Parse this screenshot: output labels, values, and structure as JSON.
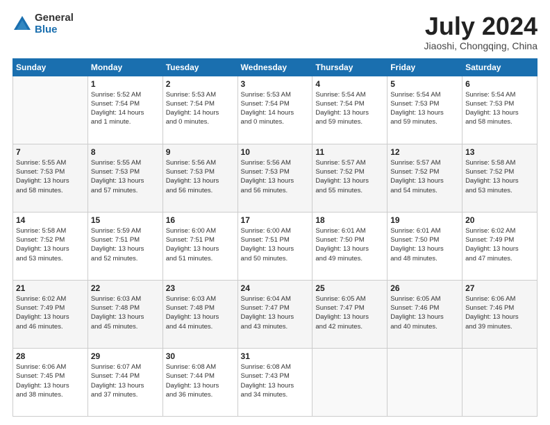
{
  "header": {
    "logo_general": "General",
    "logo_blue": "Blue",
    "title": "July 2024",
    "location": "Jiaoshi, Chongqing, China"
  },
  "weekdays": [
    "Sunday",
    "Monday",
    "Tuesday",
    "Wednesday",
    "Thursday",
    "Friday",
    "Saturday"
  ],
  "weeks": [
    [
      {
        "day": "",
        "lines": []
      },
      {
        "day": "1",
        "lines": [
          "Sunrise: 5:52 AM",
          "Sunset: 7:54 PM",
          "Daylight: 14 hours",
          "and 1 minute."
        ]
      },
      {
        "day": "2",
        "lines": [
          "Sunrise: 5:53 AM",
          "Sunset: 7:54 PM",
          "Daylight: 14 hours",
          "and 0 minutes."
        ]
      },
      {
        "day": "3",
        "lines": [
          "Sunrise: 5:53 AM",
          "Sunset: 7:54 PM",
          "Daylight: 14 hours",
          "and 0 minutes."
        ]
      },
      {
        "day": "4",
        "lines": [
          "Sunrise: 5:54 AM",
          "Sunset: 7:54 PM",
          "Daylight: 13 hours",
          "and 59 minutes."
        ]
      },
      {
        "day": "5",
        "lines": [
          "Sunrise: 5:54 AM",
          "Sunset: 7:53 PM",
          "Daylight: 13 hours",
          "and 59 minutes."
        ]
      },
      {
        "day": "6",
        "lines": [
          "Sunrise: 5:54 AM",
          "Sunset: 7:53 PM",
          "Daylight: 13 hours",
          "and 58 minutes."
        ]
      }
    ],
    [
      {
        "day": "7",
        "lines": [
          "Sunrise: 5:55 AM",
          "Sunset: 7:53 PM",
          "Daylight: 13 hours",
          "and 58 minutes."
        ]
      },
      {
        "day": "8",
        "lines": [
          "Sunrise: 5:55 AM",
          "Sunset: 7:53 PM",
          "Daylight: 13 hours",
          "and 57 minutes."
        ]
      },
      {
        "day": "9",
        "lines": [
          "Sunrise: 5:56 AM",
          "Sunset: 7:53 PM",
          "Daylight: 13 hours",
          "and 56 minutes."
        ]
      },
      {
        "day": "10",
        "lines": [
          "Sunrise: 5:56 AM",
          "Sunset: 7:53 PM",
          "Daylight: 13 hours",
          "and 56 minutes."
        ]
      },
      {
        "day": "11",
        "lines": [
          "Sunrise: 5:57 AM",
          "Sunset: 7:52 PM",
          "Daylight: 13 hours",
          "and 55 minutes."
        ]
      },
      {
        "day": "12",
        "lines": [
          "Sunrise: 5:57 AM",
          "Sunset: 7:52 PM",
          "Daylight: 13 hours",
          "and 54 minutes."
        ]
      },
      {
        "day": "13",
        "lines": [
          "Sunrise: 5:58 AM",
          "Sunset: 7:52 PM",
          "Daylight: 13 hours",
          "and 53 minutes."
        ]
      }
    ],
    [
      {
        "day": "14",
        "lines": [
          "Sunrise: 5:58 AM",
          "Sunset: 7:52 PM",
          "Daylight: 13 hours",
          "and 53 minutes."
        ]
      },
      {
        "day": "15",
        "lines": [
          "Sunrise: 5:59 AM",
          "Sunset: 7:51 PM",
          "Daylight: 13 hours",
          "and 52 minutes."
        ]
      },
      {
        "day": "16",
        "lines": [
          "Sunrise: 6:00 AM",
          "Sunset: 7:51 PM",
          "Daylight: 13 hours",
          "and 51 minutes."
        ]
      },
      {
        "day": "17",
        "lines": [
          "Sunrise: 6:00 AM",
          "Sunset: 7:51 PM",
          "Daylight: 13 hours",
          "and 50 minutes."
        ]
      },
      {
        "day": "18",
        "lines": [
          "Sunrise: 6:01 AM",
          "Sunset: 7:50 PM",
          "Daylight: 13 hours",
          "and 49 minutes."
        ]
      },
      {
        "day": "19",
        "lines": [
          "Sunrise: 6:01 AM",
          "Sunset: 7:50 PM",
          "Daylight: 13 hours",
          "and 48 minutes."
        ]
      },
      {
        "day": "20",
        "lines": [
          "Sunrise: 6:02 AM",
          "Sunset: 7:49 PM",
          "Daylight: 13 hours",
          "and 47 minutes."
        ]
      }
    ],
    [
      {
        "day": "21",
        "lines": [
          "Sunrise: 6:02 AM",
          "Sunset: 7:49 PM",
          "Daylight: 13 hours",
          "and 46 minutes."
        ]
      },
      {
        "day": "22",
        "lines": [
          "Sunrise: 6:03 AM",
          "Sunset: 7:48 PM",
          "Daylight: 13 hours",
          "and 45 minutes."
        ]
      },
      {
        "day": "23",
        "lines": [
          "Sunrise: 6:03 AM",
          "Sunset: 7:48 PM",
          "Daylight: 13 hours",
          "and 44 minutes."
        ]
      },
      {
        "day": "24",
        "lines": [
          "Sunrise: 6:04 AM",
          "Sunset: 7:47 PM",
          "Daylight: 13 hours",
          "and 43 minutes."
        ]
      },
      {
        "day": "25",
        "lines": [
          "Sunrise: 6:05 AM",
          "Sunset: 7:47 PM",
          "Daylight: 13 hours",
          "and 42 minutes."
        ]
      },
      {
        "day": "26",
        "lines": [
          "Sunrise: 6:05 AM",
          "Sunset: 7:46 PM",
          "Daylight: 13 hours",
          "and 40 minutes."
        ]
      },
      {
        "day": "27",
        "lines": [
          "Sunrise: 6:06 AM",
          "Sunset: 7:46 PM",
          "Daylight: 13 hours",
          "and 39 minutes."
        ]
      }
    ],
    [
      {
        "day": "28",
        "lines": [
          "Sunrise: 6:06 AM",
          "Sunset: 7:45 PM",
          "Daylight: 13 hours",
          "and 38 minutes."
        ]
      },
      {
        "day": "29",
        "lines": [
          "Sunrise: 6:07 AM",
          "Sunset: 7:44 PM",
          "Daylight: 13 hours",
          "and 37 minutes."
        ]
      },
      {
        "day": "30",
        "lines": [
          "Sunrise: 6:08 AM",
          "Sunset: 7:44 PM",
          "Daylight: 13 hours",
          "and 36 minutes."
        ]
      },
      {
        "day": "31",
        "lines": [
          "Sunrise: 6:08 AM",
          "Sunset: 7:43 PM",
          "Daylight: 13 hours",
          "and 34 minutes."
        ]
      },
      {
        "day": "",
        "lines": []
      },
      {
        "day": "",
        "lines": []
      },
      {
        "day": "",
        "lines": []
      }
    ]
  ]
}
